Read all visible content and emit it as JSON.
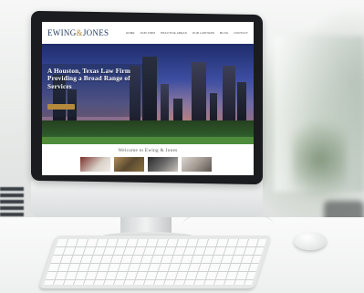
{
  "website": {
    "logo": {
      "name_a": "EWING",
      "amp": "&",
      "name_b": "JONES"
    },
    "nav": [
      "HOME",
      "OUR FIRM",
      "PRACTICE AREAS",
      "OUR LAWYERS",
      "BLOG",
      "CONTACT"
    ],
    "hero": {
      "headline": "A Houston, Texas Law Firm Providing a Broad Range of Services"
    },
    "welcome": "Welcome to Ewing & Jones"
  },
  "colors": {
    "brand_navy": "#1f3a5c",
    "brand_gold": "#b58a3c"
  }
}
